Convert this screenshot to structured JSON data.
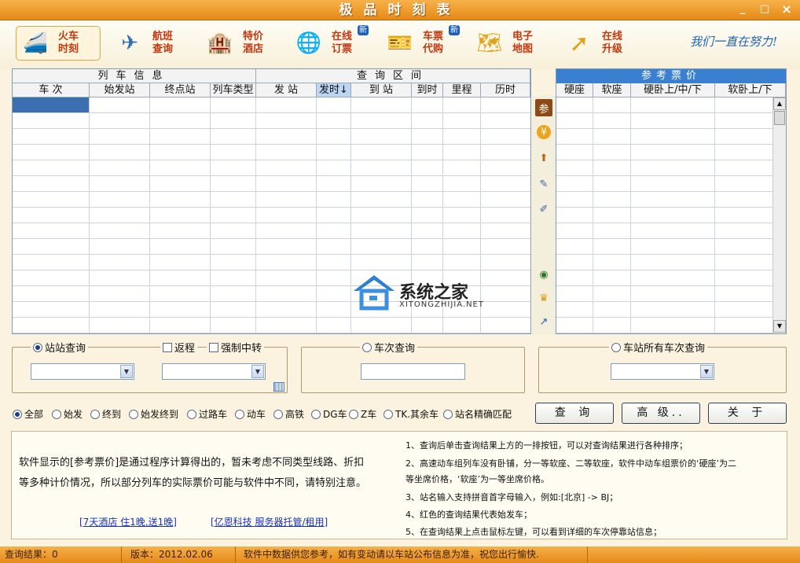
{
  "window": {
    "title": "极品时刻表",
    "min": "_",
    "max": "□",
    "close": "×"
  },
  "toolbar": {
    "items": [
      {
        "label": "火车时刻",
        "icon": "train-icon",
        "glyph": "🚄",
        "new": ""
      },
      {
        "label": "航班查询",
        "icon": "airplane-icon",
        "glyph": "✈",
        "new": ""
      },
      {
        "label": "特价酒店",
        "icon": "hotel-icon",
        "glyph": "🏨",
        "new": ""
      },
      {
        "label": "在线订票",
        "icon": "ticket-globe-icon",
        "glyph": "🌐",
        "new": "新"
      },
      {
        "label": "车票代购",
        "icon": "ticket-purchase-icon",
        "glyph": "🎫",
        "new": "新"
      },
      {
        "label": "电子地图",
        "icon": "china-map-icon",
        "glyph": "🗺",
        "new": ""
      },
      {
        "label": "在线升级",
        "icon": "upgrade-arrow-icon",
        "glyph": "➚",
        "new": ""
      }
    ],
    "slogan": "我们一直在努力!"
  },
  "grid": {
    "group_train": "列车信息",
    "group_query": "查询区间",
    "columns": [
      "车 次",
      "始发站",
      "终点站",
      "列车类型",
      "发 站",
      "发时↓",
      "到 站",
      "到时",
      "里程",
      "历时"
    ],
    "price_group": "参考票价",
    "price_columns": [
      "硬座",
      "软座",
      "硬卧上/中/下",
      "软卧上/下"
    ],
    "side_icons": [
      "参",
      "¥",
      "⬆",
      "✎",
      "✐",
      "◉",
      "♛",
      "↗"
    ],
    "watermark_title": "系统之家",
    "watermark_url": "XITONGZHIJIA.NET"
  },
  "search": {
    "station_query": "站站查询",
    "return_trip": "返程",
    "forced_transfer": "强制中转",
    "train_query": "车次查询",
    "station_all_query": "车站所有车次查询"
  },
  "filters": [
    "全部",
    "始发",
    "终到",
    "始发终到",
    "过路车",
    "动车",
    "高铁",
    "DG车",
    "Z车",
    "TK.其余车",
    "站名精确匹配"
  ],
  "buttons": {
    "query": "查 询",
    "advanced": "高 级..",
    "about": "关 于"
  },
  "notes": {
    "disclaimer_1": "软件显示的[参考票价]是通过程序计算得出的，暂未考虑不同类型线路、折扣",
    "disclaimer_2": "等多种计价情况，所以部分列车的实际票价可能与软件中不同，请特别注意。",
    "link_1": "[7天酒店 住1晚,送1晚]",
    "link_2": "[亿恩科技 服务器托管/租用]",
    "tips": [
      "1、查询后单击查询结果上方的一排按钮，可以对查询结果进行各种排序；",
      "2、高速动车组列车没有卧铺，分一等软座、二等软座，软件中动车组票价的‘硬座’为二",
      "等坐席价格，‘软座’为一等坐席价格。",
      "3、站名输入支持拼音首字母输入，例如:[北京] -> BJ；",
      "4、红色的查询结果代表始发车；",
      "5、在查询结果上点击鼠标左键，可以看到详细的车次停靠站信息；"
    ]
  },
  "status": {
    "result": "查询结果：0",
    "version": "版本：2012.02.06",
    "message": "软件中数据供您参考，如有变动请以车站公布信息为准，祝您出行愉快."
  },
  "colors": {
    "accent": "#e58a18",
    "header_blue": "#3a7fd0",
    "selection": "#3a6fb0"
  }
}
